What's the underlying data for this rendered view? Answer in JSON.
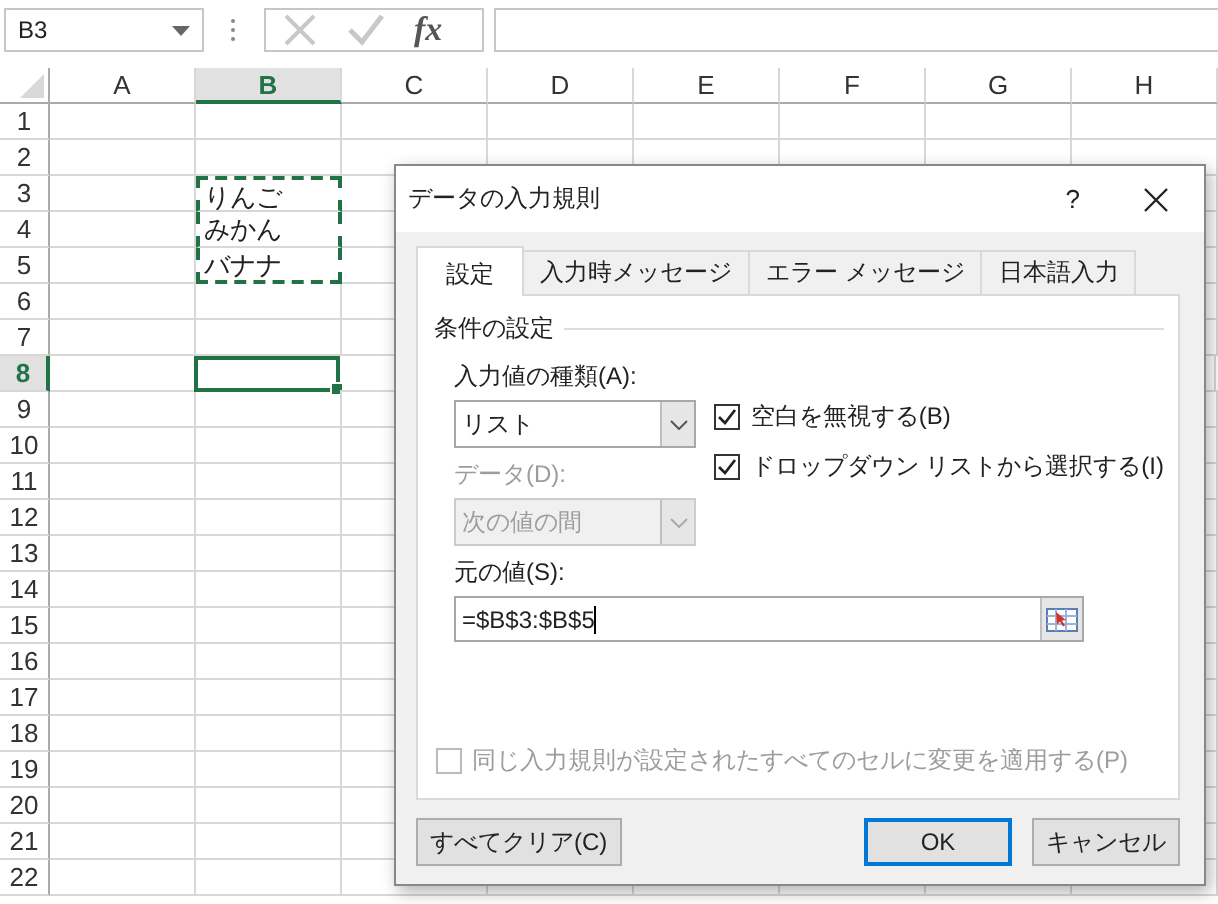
{
  "name_box": {
    "value": "B3"
  },
  "formula_bar": {
    "fx_label": "fx"
  },
  "columns": [
    {
      "label": "A",
      "selected": false
    },
    {
      "label": "B",
      "selected": true
    },
    {
      "label": "C",
      "selected": false
    },
    {
      "label": "D",
      "selected": false
    },
    {
      "label": "E",
      "selected": false
    },
    {
      "label": "F",
      "selected": false
    },
    {
      "label": "G",
      "selected": false
    },
    {
      "label": "H",
      "selected": false
    }
  ],
  "rows": [
    {
      "label": "1",
      "selected": false
    },
    {
      "label": "2",
      "selected": false
    },
    {
      "label": "3",
      "selected": false,
      "column_b": "りんご",
      "in_copy_range": true
    },
    {
      "label": "4",
      "selected": false,
      "column_b": "みかん",
      "in_copy_range": true
    },
    {
      "label": "5",
      "selected": false,
      "column_b": "バナナ",
      "in_copy_range": true
    },
    {
      "label": "6",
      "selected": false
    },
    {
      "label": "7",
      "selected": false
    },
    {
      "label": "8",
      "selected": true
    },
    {
      "label": "9",
      "selected": false
    },
    {
      "label": "10",
      "selected": false
    },
    {
      "label": "11",
      "selected": false
    },
    {
      "label": "12",
      "selected": false
    },
    {
      "label": "13",
      "selected": false
    },
    {
      "label": "14",
      "selected": false
    },
    {
      "label": "15",
      "selected": false
    },
    {
      "label": "16",
      "selected": false
    },
    {
      "label": "17",
      "selected": false
    },
    {
      "label": "18",
      "selected": false
    },
    {
      "label": "19",
      "selected": false
    },
    {
      "label": "20",
      "selected": false
    },
    {
      "label": "21",
      "selected": false
    },
    {
      "label": "22",
      "selected": false
    }
  ],
  "dialog": {
    "title": "データの入力規則",
    "help": "?",
    "tabs": [
      {
        "label": "設定",
        "selected": true
      },
      {
        "label": "入力時メッセージ",
        "selected": false
      },
      {
        "label": "エラー メッセージ",
        "selected": false
      },
      {
        "label": "日本語入力",
        "selected": false
      }
    ],
    "group_title": "条件の設定",
    "allow": {
      "label": "入力値の種類(A):",
      "value": "リスト",
      "disabled": false
    },
    "data": {
      "label": "データ(D):",
      "value": "次の値の間",
      "disabled": true
    },
    "checkboxes": [
      {
        "label": "空白を無視する(B)",
        "checked": true
      },
      {
        "label": "ドロップダウン リストから選択する(I)",
        "checked": true
      }
    ],
    "source": {
      "label": "元の値(S):",
      "value": "=$B$3:$B$5"
    },
    "apply_all": {
      "label": "同じ入力規則が設定されたすべてのセルに変更を適用する(P)",
      "checked": false,
      "disabled": true
    },
    "buttons": [
      {
        "label": "すべてクリア(C)",
        "default": false
      },
      {
        "label": "OK",
        "default": true
      },
      {
        "label": "キャンセル",
        "default": false
      }
    ]
  }
}
